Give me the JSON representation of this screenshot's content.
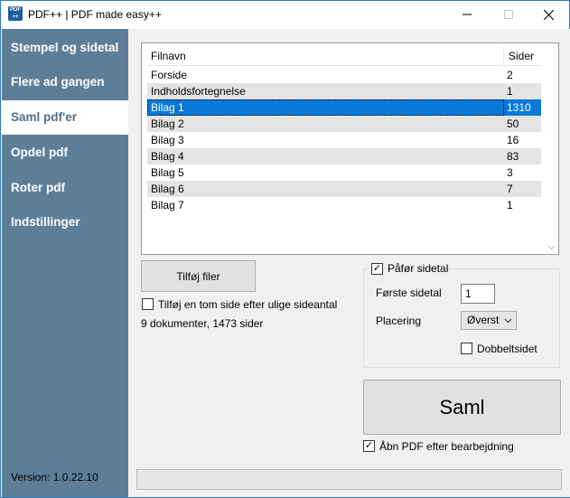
{
  "window": {
    "title": "PDF++ | PDF made easy++",
    "icon_text_top": "PDF",
    "icon_text_bottom": "++"
  },
  "sidebar": {
    "items": [
      {
        "label": "Stempel og sidetal",
        "active": false
      },
      {
        "label": "Flere ad gangen",
        "active": false
      },
      {
        "label": "Saml pdf'er",
        "active": true
      },
      {
        "label": "Opdel pdf",
        "active": false
      },
      {
        "label": "Roter pdf",
        "active": false
      },
      {
        "label": "Indstillinger",
        "active": false
      }
    ],
    "version": "Version: 1.0.22.10"
  },
  "file_list": {
    "columns": {
      "name": "Filnavn",
      "pages": "Sider"
    },
    "rows": [
      {
        "name": "Forside",
        "pages": "2"
      },
      {
        "name": "Indholdsfortegnelse",
        "pages": "1"
      },
      {
        "name": "Bilag 1",
        "pages": "1310"
      },
      {
        "name": "Bilag 2",
        "pages": "50"
      },
      {
        "name": "Bilag 3",
        "pages": "16"
      },
      {
        "name": "Bilag 4",
        "pages": "83"
      },
      {
        "name": "Bilag 5",
        "pages": "3"
      },
      {
        "name": "Bilag 6",
        "pages": "7"
      },
      {
        "name": "Bilag 7",
        "pages": "1"
      }
    ],
    "selected_row": 2
  },
  "add_files_button": "Tilføj filer",
  "blank_page_option": {
    "label": "Tilføj en tom side efter ulige sideantal",
    "checked": false
  },
  "summary": "9 dokumenter, 1473 sider",
  "page_numbers": {
    "label": "Påfør sidetal",
    "checked": true,
    "first_page_label": "Første sidetal",
    "first_page_value": "1",
    "placement_label": "Placering",
    "placement_value": "Øverst",
    "double_sided_label": "Dobbeltsidet",
    "double_sided_checked": false
  },
  "merge_button": "Saml",
  "open_after": {
    "label": "Åbn PDF efter bearbejdning",
    "checked": true
  },
  "progress": {
    "value": 0
  },
  "colors": {
    "sidebar": "#5e7e98",
    "selection": "#0b78d7",
    "active_text": "#4f6f8c"
  },
  "icons": {
    "minimize": "minimize-icon",
    "maximize": "maximize-icon",
    "close": "close-icon",
    "dropdown": "chevron-down-icon",
    "scroll": "chevron-down-icon"
  }
}
